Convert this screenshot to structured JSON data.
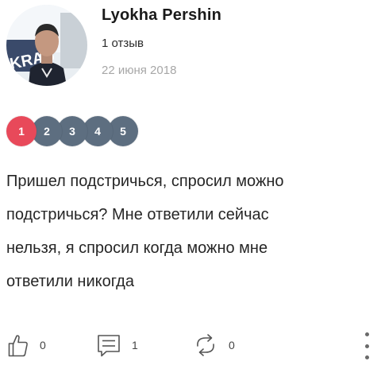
{
  "user": {
    "name": "Lyokha Pershin",
    "review_count": "1 отзыв",
    "date": "22 июня 2018",
    "avatar_sign_text": "KRAS"
  },
  "rating": {
    "selected_value": 1,
    "options": [
      "1",
      "2",
      "3",
      "4",
      "5"
    ],
    "selected_color": "#e8495a",
    "default_color": "#5d6e80"
  },
  "review": {
    "text": "Пришел подстричься, спросил можно\nподстричься? Мне ответили сейчас\nнельзя, я спросил когда можно мне\nответили никогда"
  },
  "actions": {
    "like_count": "0",
    "comment_count": "1",
    "repost_count": "0",
    "like_icon": "thumbs-up-icon",
    "comment_icon": "comment-icon",
    "repost_icon": "repost-icon",
    "more_icon": "more-vertical-icon"
  }
}
